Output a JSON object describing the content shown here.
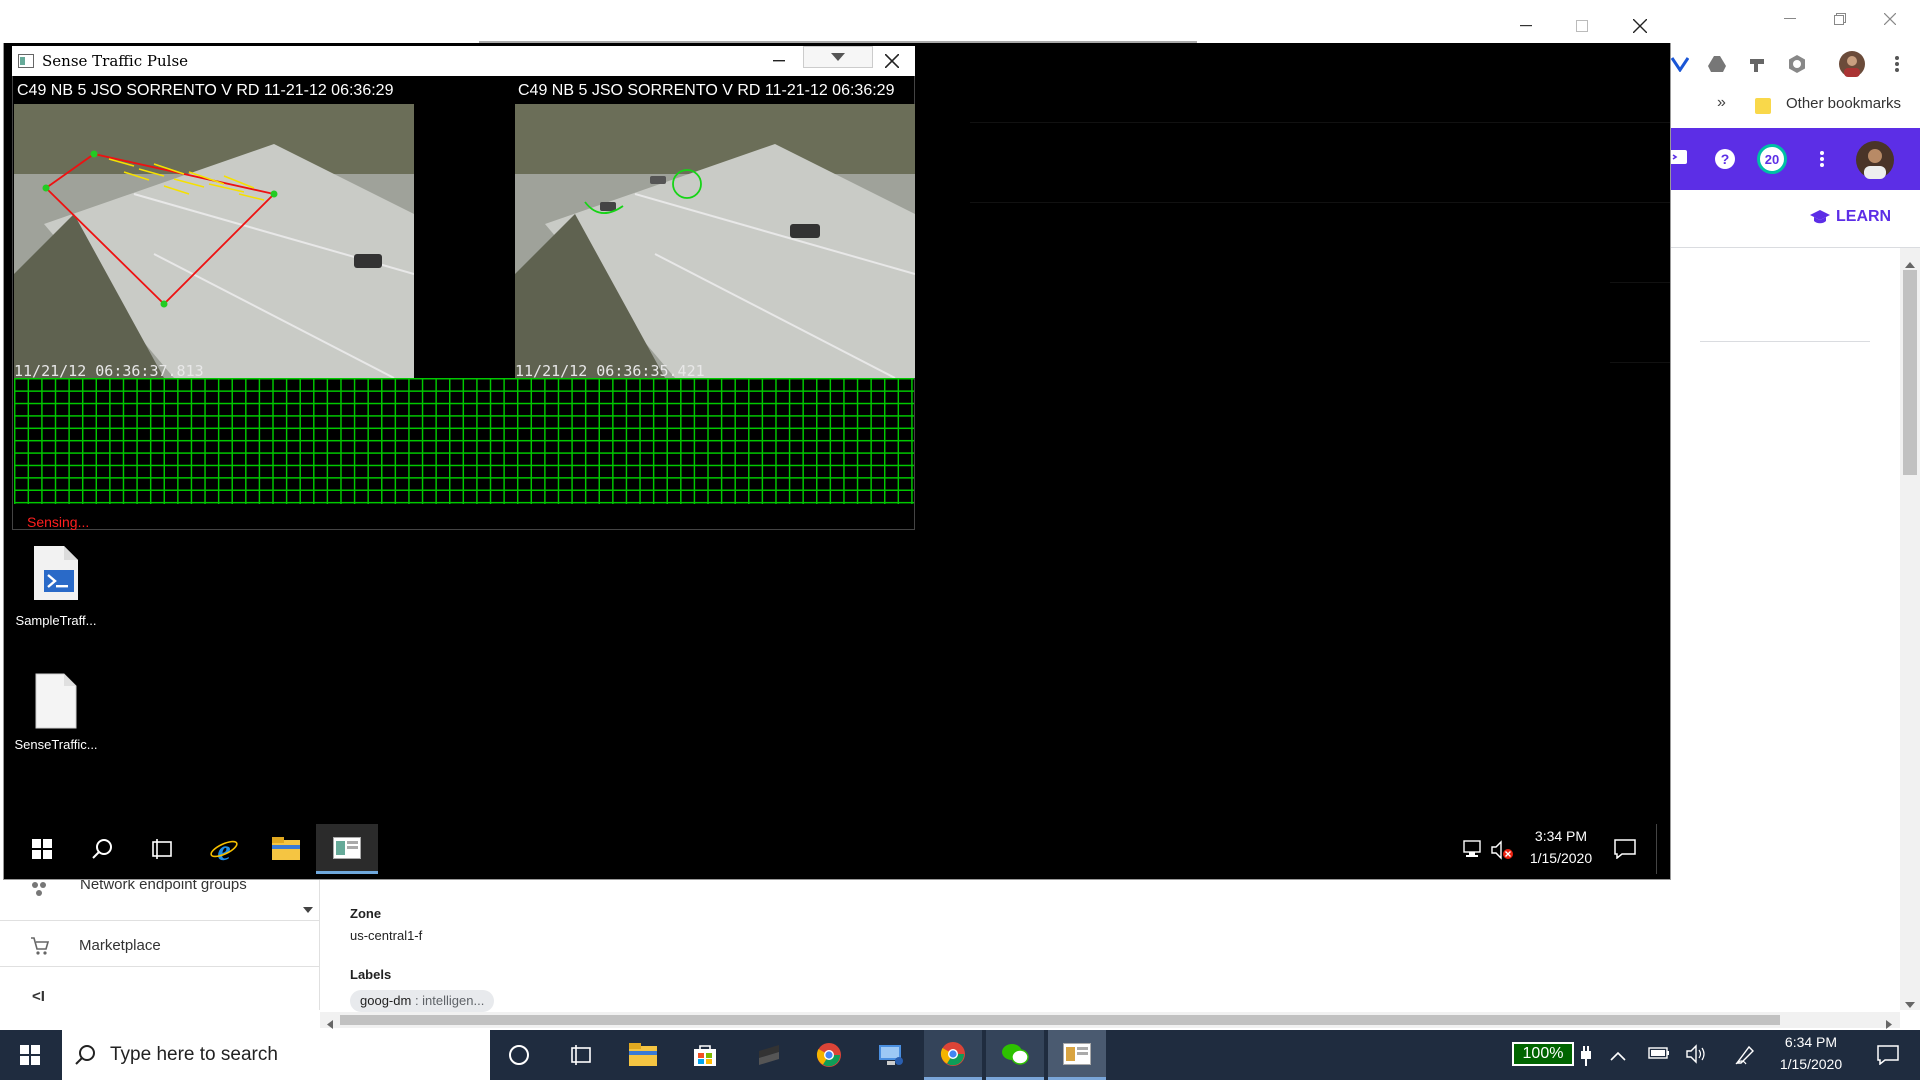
{
  "chrome": {
    "bookmarks_overflow": "»",
    "other_bookmarks": "Other bookmarks",
    "notification_count": "20",
    "learn_label": "LEARN"
  },
  "gcp": {
    "sidebar": {
      "items": [
        {
          "label": "Network endpoint groups",
          "icon": "network-endpoint-icon"
        },
        {
          "label": "Marketplace",
          "icon": "cart-icon"
        }
      ],
      "collapse_label": "<I"
    },
    "details": {
      "zone_label": "Zone",
      "zone_value": "us-central1-f",
      "labels_label": "Labels",
      "label_chip_key": "goog-dm",
      "label_chip_value": ": intelligen..."
    }
  },
  "app": {
    "title": "Sense Traffic Pulse",
    "cameras": [
      {
        "header": "C49 NB 5 JSO SORRENTO V RD  11-21-12 06:36:29",
        "timestamp": "11/21/12 06:36:37.813"
      },
      {
        "header": "C49 NB 5 JSO SORRENTO V RD  11-21-12 06:36:29",
        "timestamp": "11/21/12 06:36:35.421"
      }
    ],
    "status": "Sensing..."
  },
  "desktop_icons": [
    {
      "label": "SampleTraff...",
      "icon": "powershell-script-icon"
    },
    {
      "label": "SenseTraffic...",
      "icon": "blank-file-icon"
    }
  ],
  "rdp_taskbar": {
    "time": "3:34 PM",
    "date": "1/15/2020"
  },
  "host_taskbar": {
    "search_placeholder": "Type here to search",
    "battery_percent": "100%",
    "time": "6:34 PM",
    "date": "1/15/2020"
  },
  "colors": {
    "gcp_header": "#5c2ee6",
    "grid_green": "#00c800",
    "status_red": "#ff1f1f",
    "learn_purple": "#5c2ee6"
  }
}
